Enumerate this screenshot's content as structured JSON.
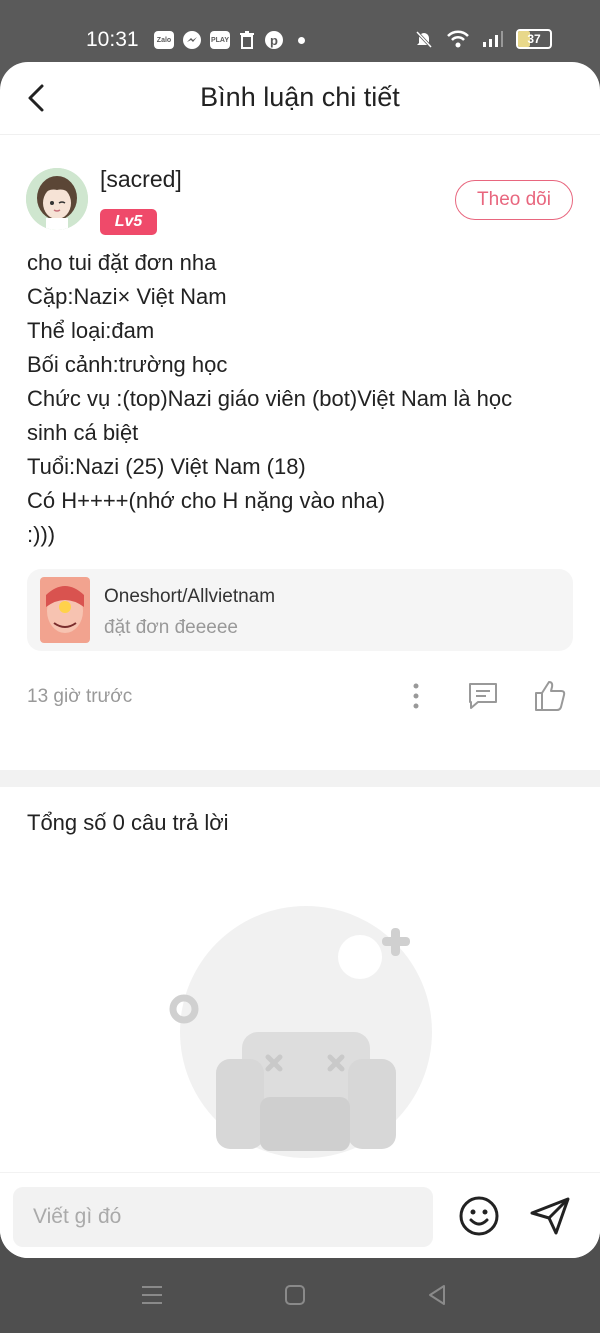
{
  "status_bar": {
    "time": "10:31",
    "apps": [
      "Zalo",
      "messenger-icon",
      "PLAY",
      "trash-icon",
      "pinterest-icon"
    ],
    "battery_level": "37"
  },
  "header": {
    "title": "Bình luận chi tiết"
  },
  "post": {
    "username": "[sacred]",
    "level": "Lv5",
    "follow_label": "Theo dõi",
    "lines": [
      "cho tui đặt đơn nha",
      "Cặp:Nazi× Việt Nam",
      "Thể loại:đam",
      "Bối cảnh:trường học",
      "Chức vụ :(top)Nazi giáo viên (bot)Việt Nam là học",
      "sinh cá biệt",
      "Tuổi:Nazi (25) Việt Nam (18)",
      "Có H++++(nhớ cho H nặng vào nha)",
      ":)))"
    ],
    "story": {
      "title": "Oneshort/Allvietnam",
      "subtitle": "đặt đơn đeeeee"
    },
    "time": "13 giờ trước"
  },
  "replies": {
    "count_text": "Tổng số 0 câu trả lời"
  },
  "composer": {
    "placeholder": "Viết gì đó"
  },
  "colors": {
    "accent": "#ef4a6a",
    "follow": "#e8667e"
  }
}
